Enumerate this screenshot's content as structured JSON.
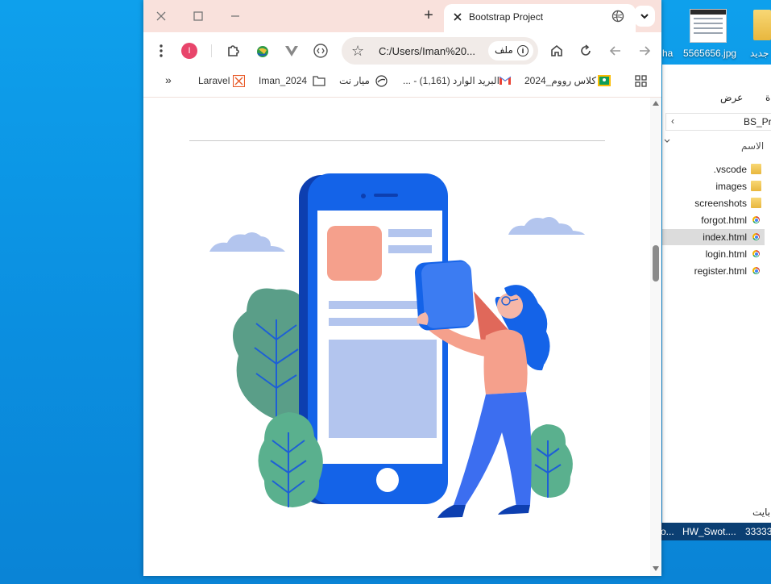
{
  "desktop": {
    "icons": [
      {
        "label": "5565656.jpg"
      },
      {
        "label": "ha"
      },
      {
        "label": "جديد"
      }
    ]
  },
  "explorer": {
    "view_tab": "عرض",
    "edge_tab": "ة",
    "path": "BS_Pro",
    "column_header": "الاسم",
    "files": [
      {
        "name": ".vscode",
        "type": "folder"
      },
      {
        "name": "images",
        "type": "folder"
      },
      {
        "name": "screenshots",
        "type": "folder"
      },
      {
        "name": "forgot.html",
        "type": "html"
      },
      {
        "name": "index.html",
        "type": "html",
        "selected": true
      },
      {
        "name": "login.html",
        "type": "html"
      },
      {
        "name": "register.html",
        "type": "html"
      }
    ],
    "status": "بايت"
  },
  "taskbar": {
    "items": [
      "o...",
      "HW_Swot....",
      "33333"
    ]
  },
  "browser": {
    "tab_title": "Bootstrap Project",
    "url": "C:/Users/Iman%20...",
    "url_chip": "ملف",
    "avatar_letter": "I",
    "bookmarks": [
      {
        "label": "كلاس رووم_2024",
        "icon": "classroom-icon"
      },
      {
        "label": "البريد الوارد (1,161) - ...",
        "icon": "gmail-icon"
      },
      {
        "label": "ميار نت",
        "icon": "site-icon"
      },
      {
        "label": "Iman_2024",
        "icon": "folder-icon"
      },
      {
        "label": "Laravel",
        "icon": "laravel-icon"
      }
    ],
    "more_bookmarks": "»"
  },
  "colors": {
    "tabstrip": "#f9e1dc",
    "phone_blue": "#1463e8",
    "phone_dark": "#0d3fb0",
    "screen_light": "#b3c5ee",
    "card_salmon": "#f5a08c",
    "leaf_green": "#5a9e88",
    "cloud": "#b3c5ee"
  }
}
